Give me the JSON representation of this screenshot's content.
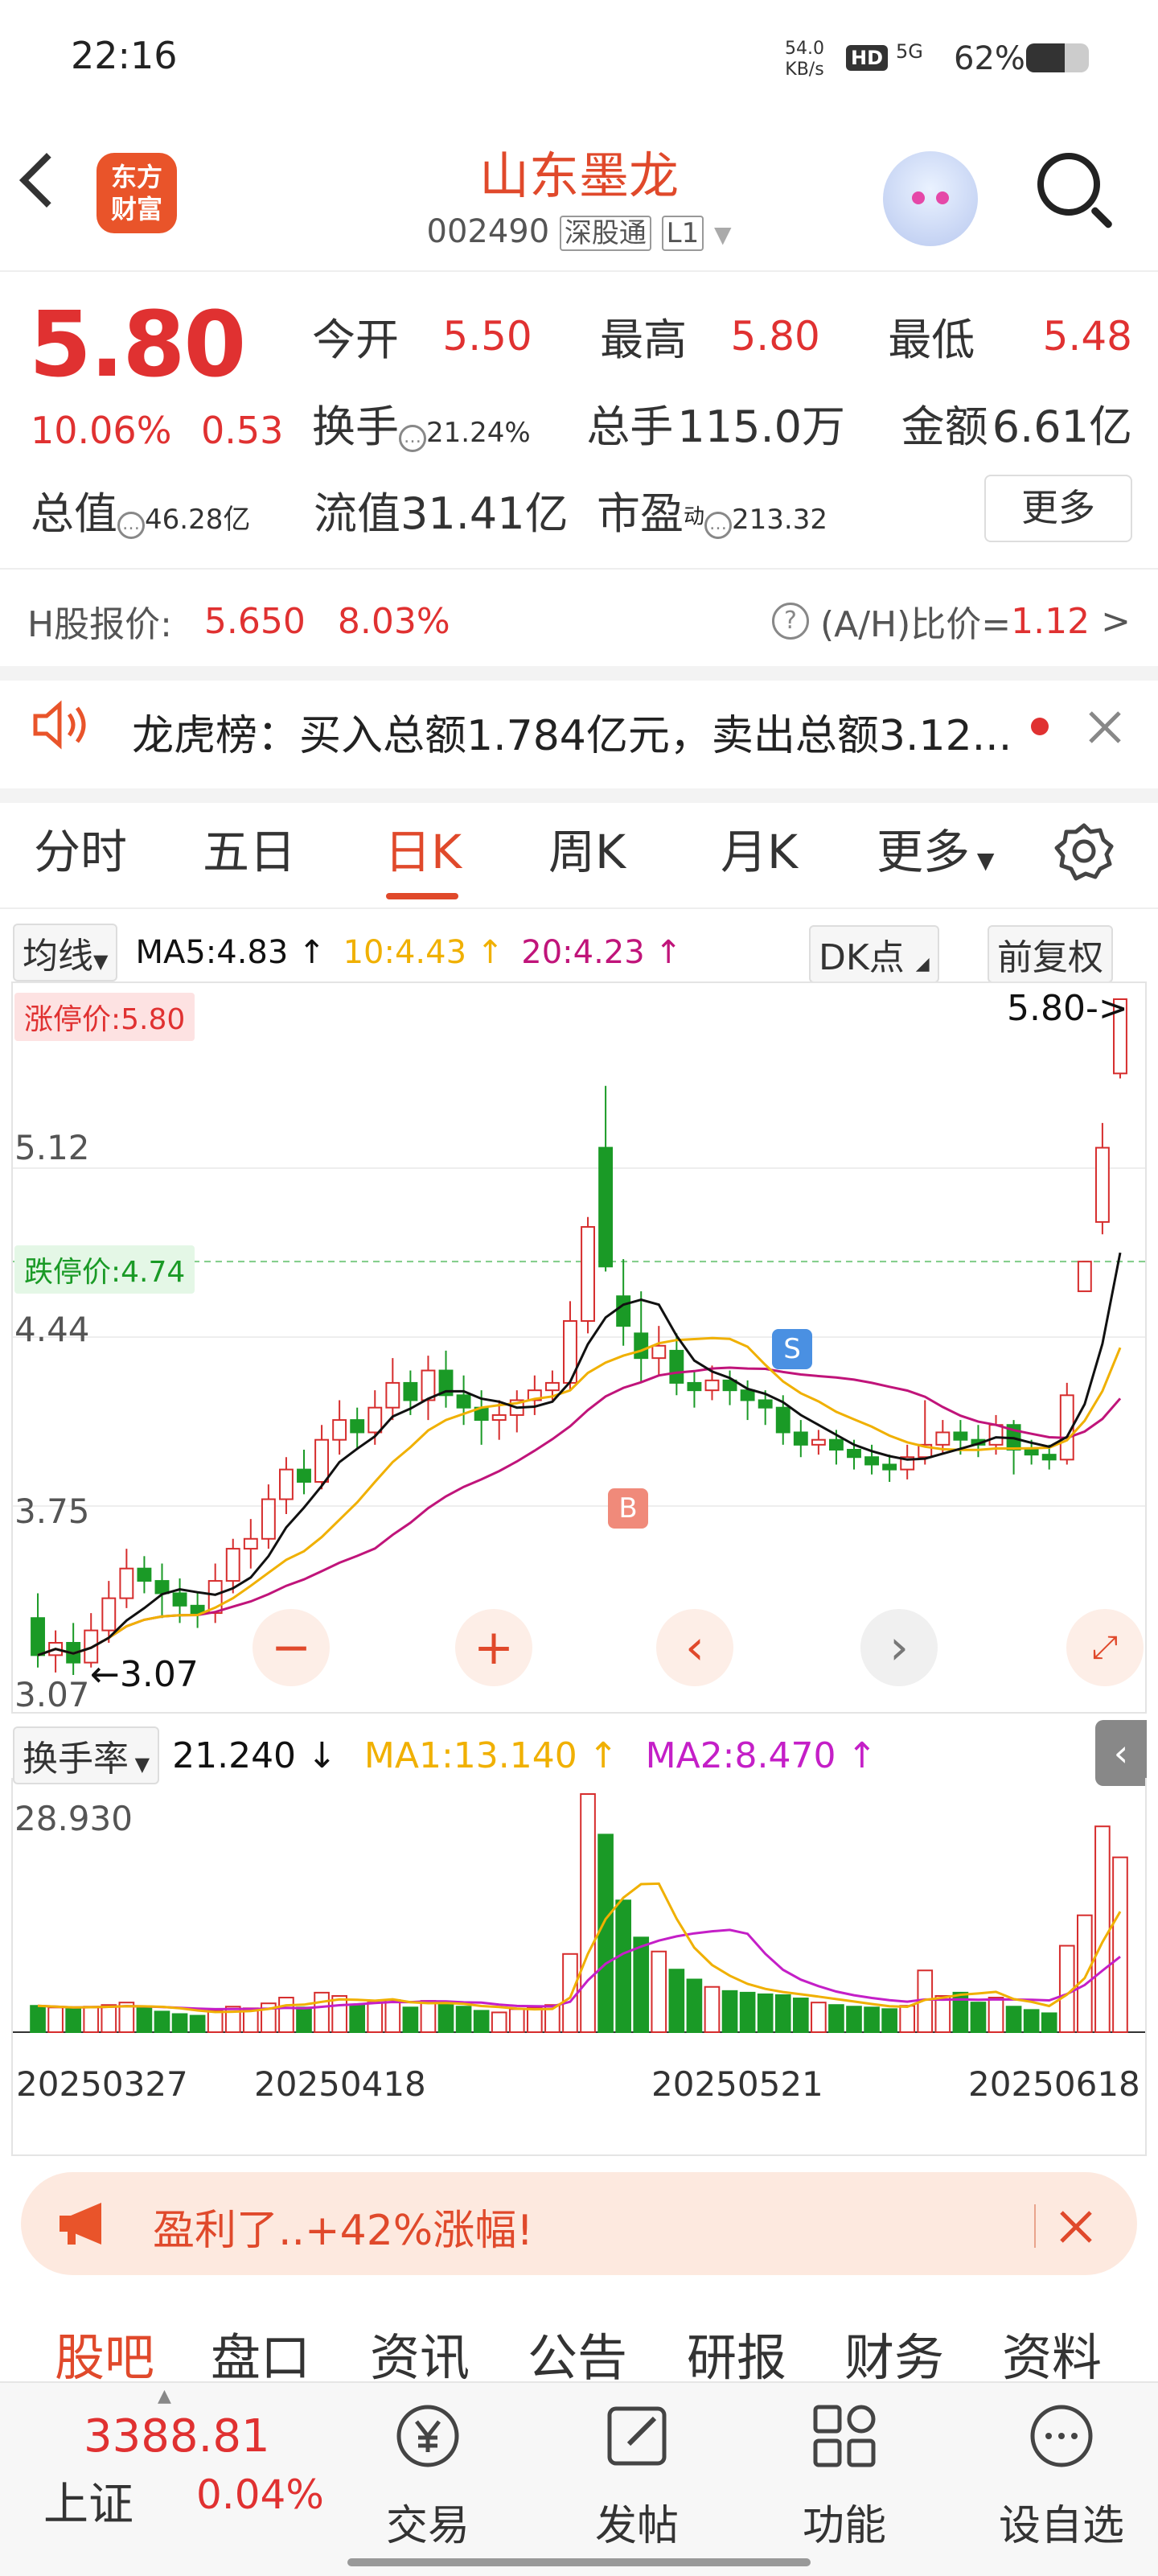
{
  "status_bar": {
    "time": "22:16",
    "net_speed": "54.0",
    "net_unit": "KB/s",
    "hd": "HD",
    "signal": "5G",
    "battery": "62%",
    "battery_level": 0.62
  },
  "header": {
    "logo_line1": "东方",
    "logo_line2": "财富",
    "stock_name": "山东墨龙",
    "stock_code": "002490",
    "connect_tag": "深股通",
    "level_tag": "L1"
  },
  "quote": {
    "price": "5.80",
    "change_pct": "10.06%",
    "change_amt": "0.53",
    "open_label": "今开",
    "open": "5.50",
    "high_label": "最高",
    "high": "5.80",
    "low_label": "最低",
    "low": "5.48",
    "turnover_label": "换手",
    "turnover": "21.24%",
    "volume_label": "总手",
    "volume": "115.0万",
    "amount_label": "金额",
    "amount": "6.61亿",
    "mktcap_label": "总值",
    "mktcap": "46.28亿",
    "float_label": "流值",
    "float": "31.41亿",
    "pe_label": "市盈",
    "pe_super": "动",
    "pe": "213.32",
    "more_button": "更多"
  },
  "h_share": {
    "label": "H股报价:",
    "price": "5.650",
    "change": "8.03%",
    "ah_label": "(A/H)比价=",
    "ah_value": "1.12",
    "arrow": ">"
  },
  "dragon_tiger": {
    "text": "龙虎榜：买入总额1.784亿元，卖出总额3.12..."
  },
  "tabs": [
    "分时",
    "五日",
    "日K",
    "周K",
    "月K",
    "更多"
  ],
  "ma_bar": {
    "selector": "均线",
    "ma5": "MA5:4.83",
    "ma10": "10:4.43",
    "ma20": "20:4.23",
    "dk": "DK点",
    "adjust": "前复权"
  },
  "kline": {
    "limit_up_label": "涨停价:5.80",
    "limit_down_label": "跌停价:4.74",
    "y_labels": [
      "5.12",
      "4.44",
      "3.75",
      "3.07"
    ],
    "top_label": "5.80",
    "cur_marker": "5.80->",
    "low_marker": "3.07",
    "b_marker": "B",
    "s_marker": "S"
  },
  "chart_data": {
    "type": "candlestick",
    "y_range": [
      3.07,
      5.8
    ],
    "ma_colors": {
      "ma5": "#111111",
      "ma10": "#f0b000",
      "ma20": "#c0147a"
    },
    "candles": [
      [
        3.3,
        3.15,
        3.4,
        3.1
      ],
      [
        3.15,
        3.2,
        3.25,
        3.08
      ],
      [
        3.2,
        3.12,
        3.28,
        3.07
      ],
      [
        3.12,
        3.25,
        3.32,
        3.1
      ],
      [
        3.25,
        3.38,
        3.45,
        3.2
      ],
      [
        3.38,
        3.5,
        3.58,
        3.34
      ],
      [
        3.5,
        3.45,
        3.55,
        3.4
      ],
      [
        3.45,
        3.4,
        3.52,
        3.3
      ],
      [
        3.4,
        3.35,
        3.46,
        3.28
      ],
      [
        3.35,
        3.32,
        3.4,
        3.26
      ],
      [
        3.32,
        3.45,
        3.52,
        3.28
      ],
      [
        3.45,
        3.58,
        3.62,
        3.4
      ],
      [
        3.58,
        3.62,
        3.7,
        3.5
      ],
      [
        3.62,
        3.78,
        3.84,
        3.58
      ],
      [
        3.78,
        3.9,
        3.95,
        3.72
      ],
      [
        3.9,
        3.85,
        3.98,
        3.8
      ],
      [
        3.85,
        4.02,
        4.08,
        3.82
      ],
      [
        4.02,
        4.1,
        4.18,
        3.96
      ],
      [
        4.1,
        4.05,
        4.15,
        3.98
      ],
      [
        4.05,
        4.15,
        4.22,
        4.0
      ],
      [
        4.15,
        4.25,
        4.35,
        4.1
      ],
      [
        4.25,
        4.18,
        4.3,
        4.12
      ],
      [
        4.18,
        4.3,
        4.36,
        4.1
      ],
      [
        4.3,
        4.2,
        4.38,
        4.15
      ],
      [
        4.2,
        4.15,
        4.28,
        4.08
      ],
      [
        4.15,
        4.1,
        4.22,
        4.0
      ],
      [
        4.1,
        4.12,
        4.18,
        4.02
      ],
      [
        4.12,
        4.18,
        4.22,
        4.05
      ],
      [
        4.18,
        4.22,
        4.28,
        4.12
      ],
      [
        4.22,
        4.25,
        4.3,
        4.18
      ],
      [
        4.25,
        4.5,
        4.58,
        4.22
      ],
      [
        4.5,
        4.88,
        4.92,
        4.45
      ],
      [
        5.2,
        4.72,
        5.45,
        4.7
      ],
      [
        4.6,
        4.48,
        4.75,
        4.4
      ],
      [
        4.45,
        4.35,
        4.62,
        4.25
      ],
      [
        4.35,
        4.4,
        4.48,
        4.28
      ],
      [
        4.38,
        4.25,
        4.45,
        4.2
      ],
      [
        4.25,
        4.22,
        4.3,
        4.15
      ],
      [
        4.22,
        4.26,
        4.32,
        4.18
      ],
      [
        4.26,
        4.22,
        4.3,
        4.16
      ],
      [
        4.22,
        4.18,
        4.26,
        4.1
      ],
      [
        4.18,
        4.15,
        4.22,
        4.08
      ],
      [
        4.15,
        4.05,
        4.2,
        4.0
      ],
      [
        4.05,
        4.0,
        4.1,
        3.95
      ],
      [
        4.0,
        4.02,
        4.06,
        3.96
      ],
      [
        4.02,
        3.98,
        4.06,
        3.92
      ],
      [
        3.98,
        3.95,
        4.02,
        3.9
      ],
      [
        3.95,
        3.92,
        4.0,
        3.88
      ],
      [
        3.92,
        3.9,
        3.96,
        3.85
      ],
      [
        3.9,
        3.95,
        4.0,
        3.86
      ],
      [
        3.95,
        4.0,
        4.18,
        3.92
      ],
      [
        4.0,
        4.05,
        4.1,
        3.96
      ],
      [
        4.05,
        4.02,
        4.1,
        3.96
      ],
      [
        4.02,
        4.0,
        4.08,
        3.95
      ],
      [
        4.0,
        4.08,
        4.12,
        3.96
      ],
      [
        4.08,
        3.98,
        4.1,
        3.88
      ],
      [
        3.98,
        3.96,
        4.02,
        3.92
      ],
      [
        3.96,
        3.94,
        4.0,
        3.9
      ],
      [
        3.94,
        4.2,
        4.25,
        3.92
      ],
      [
        4.62,
        4.74,
        4.74,
        4.74
      ],
      [
        4.9,
        5.2,
        5.3,
        4.85
      ],
      [
        5.5,
        5.8,
        5.8,
        5.48
      ]
    ],
    "volume_max": 28.93,
    "volume": [
      3.2,
      3.0,
      2.8,
      3.1,
      3.3,
      3.6,
      2.9,
      2.5,
      2.2,
      2.0,
      2.6,
      3.1,
      2.9,
      3.5,
      4.2,
      3.0,
      4.8,
      4.4,
      3.3,
      3.6,
      3.9,
      3.0,
      3.8,
      3.4,
      3.1,
      2.6,
      2.4,
      2.8,
      3.0,
      3.3,
      9.5,
      28.93,
      24.0,
      16.0,
      11.5,
      9.8,
      7.6,
      6.4,
      5.5,
      5.0,
      4.8,
      4.6,
      4.5,
      4.1,
      3.6,
      3.3,
      3.1,
      3.0,
      2.8,
      3.2,
      7.5,
      4.4,
      4.8,
      3.6,
      4.2,
      3.1,
      2.7,
      2.3,
      10.5,
      14.2,
      25.0,
      21.24
    ],
    "dates": [
      "20250327",
      "20250418",
      "20250521",
      "20250618"
    ]
  },
  "volume_bar": {
    "selector": "换手率",
    "value": "21.240",
    "ma1": "MA1:13.140",
    "ma2": "MA2:8.470",
    "max_label": "28.930"
  },
  "promo": {
    "text": "盈利了..+42%涨幅!"
  },
  "sub_tabs": [
    "股吧",
    "盘口",
    "资讯",
    "公告",
    "研报",
    "财务",
    "资料"
  ],
  "bottom_bar": {
    "index_value": "3388.81",
    "index_name": "上证",
    "index_change": "0.04%",
    "items": [
      "交易",
      "发帖",
      "功能",
      "设自选"
    ]
  }
}
